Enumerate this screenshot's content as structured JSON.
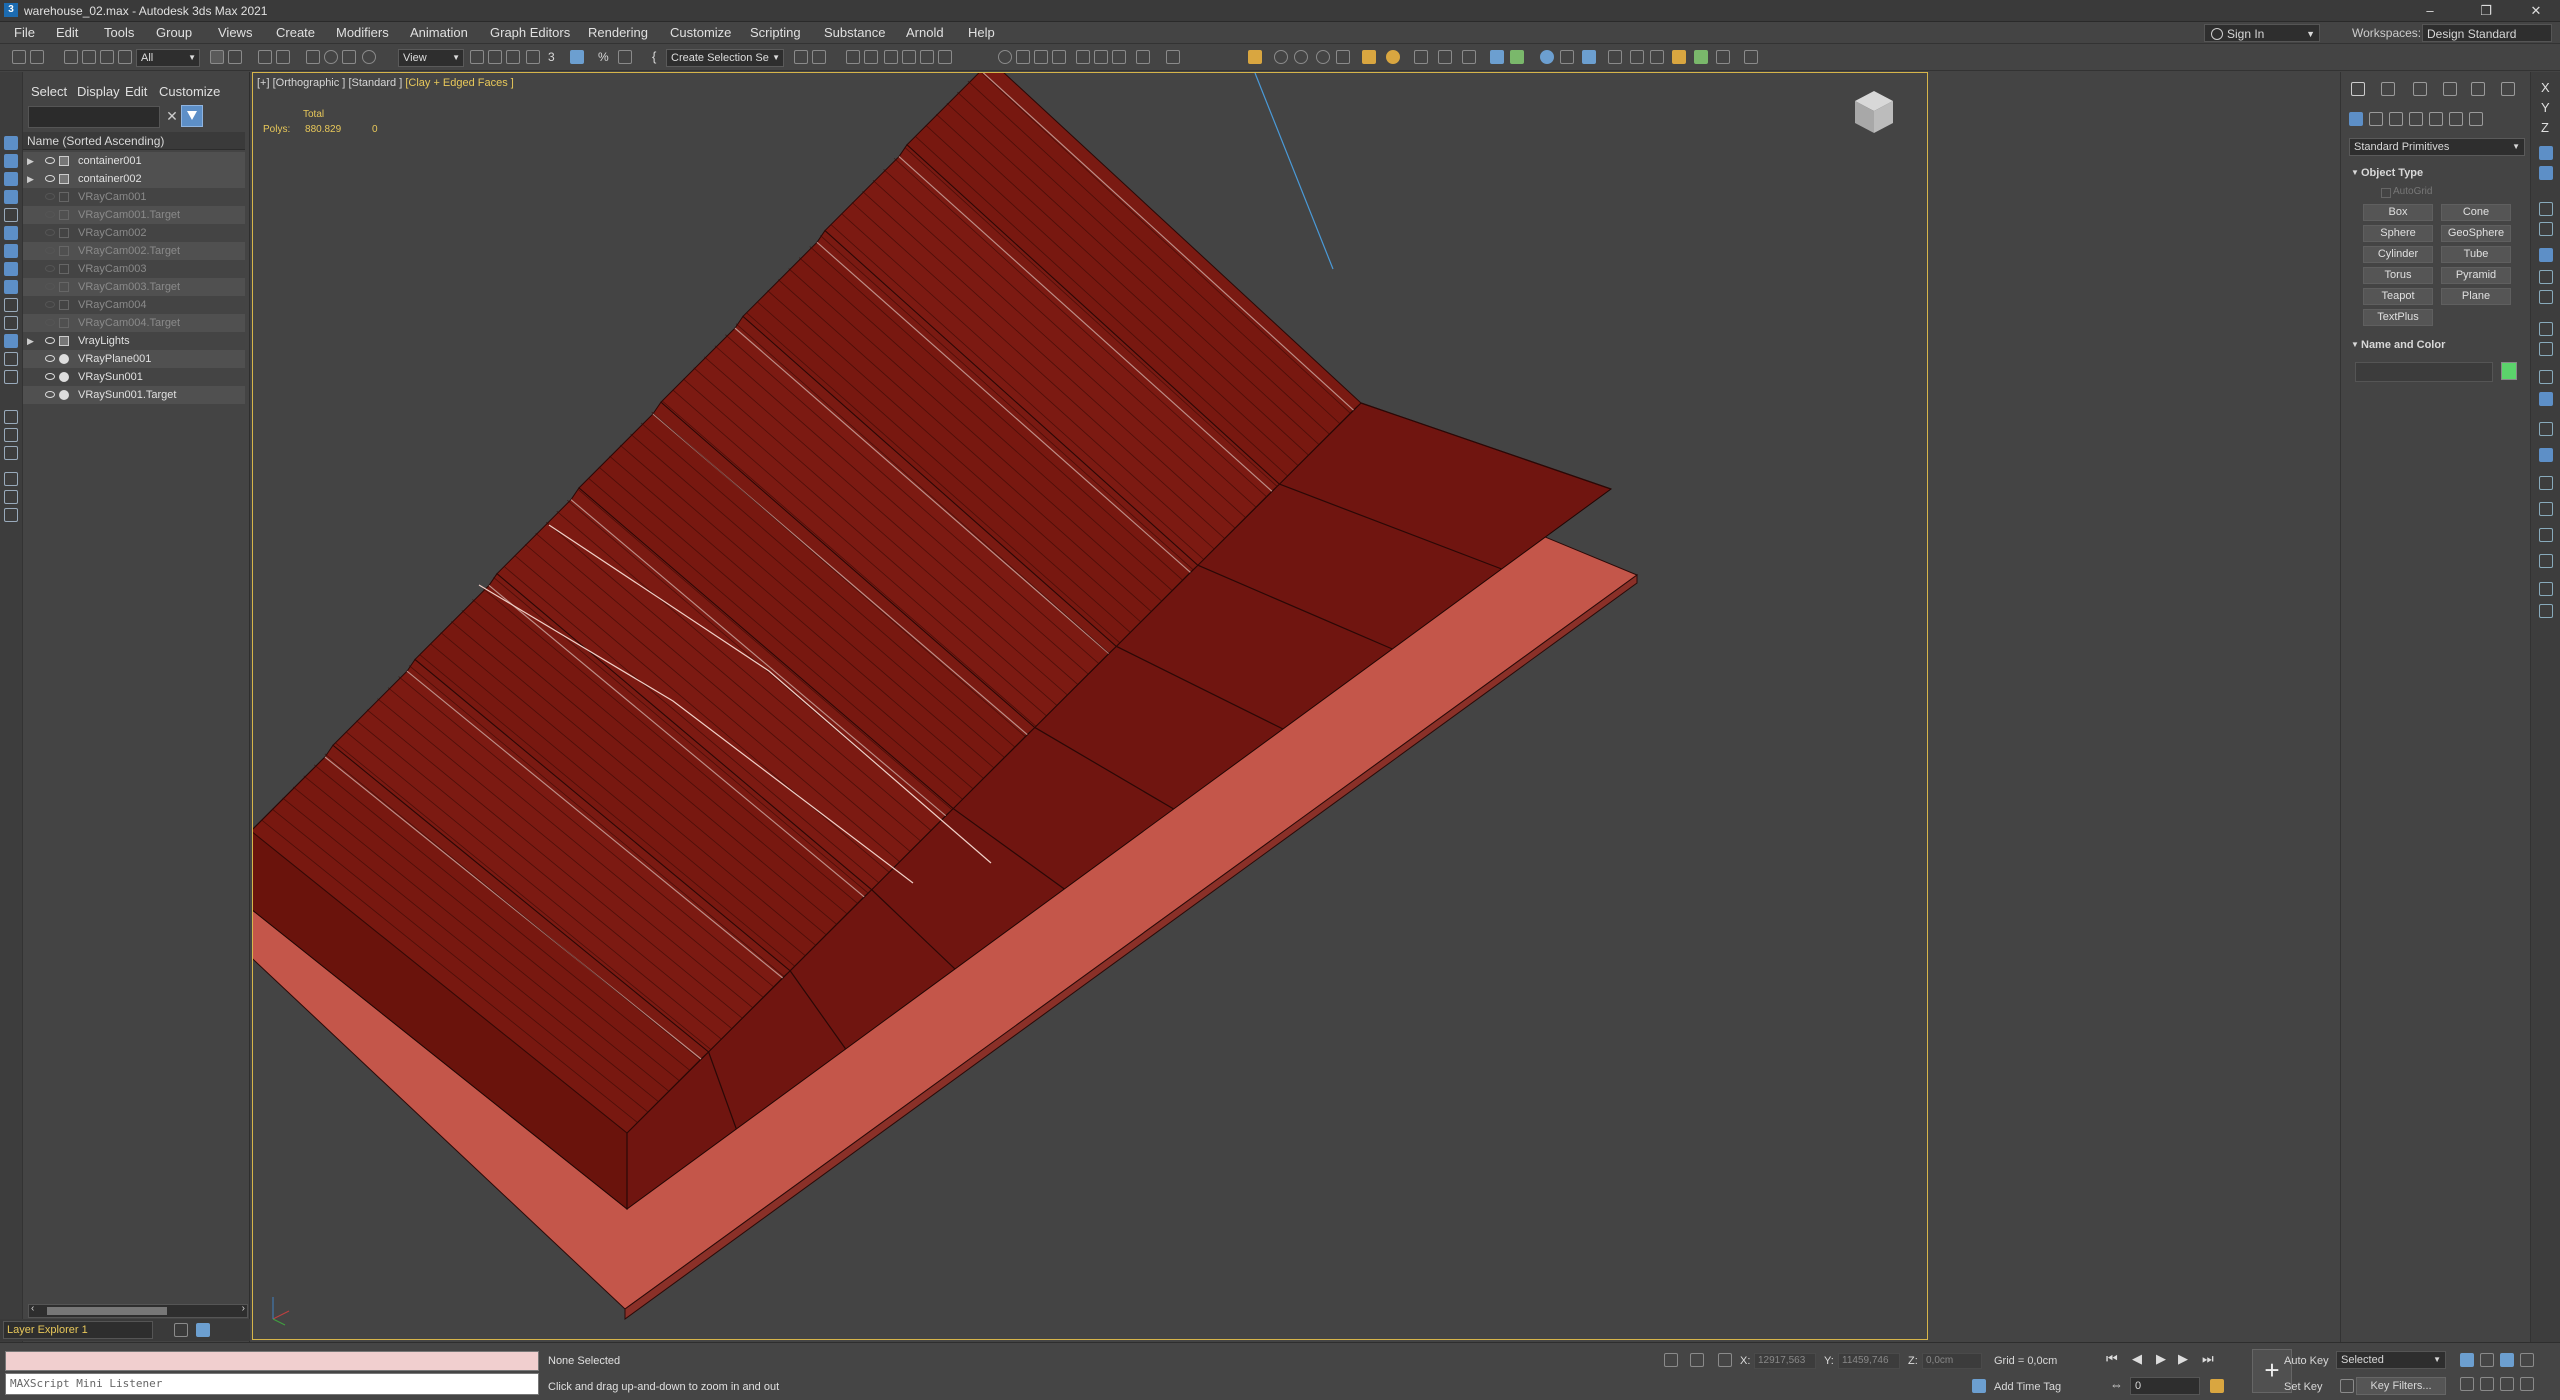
{
  "titlebar": {
    "title": "warehouse_02.max - Autodesk 3ds Max 2021",
    "app_icon": "3",
    "minimize": "–",
    "maximize": "❐",
    "close": "✕"
  },
  "menu": [
    "File",
    "Edit",
    "Tools",
    "Group",
    "Views",
    "Create",
    "Modifiers",
    "Animation",
    "Graph Editors",
    "Rendering",
    "Customize",
    "Scripting",
    "Substance",
    "Arnold",
    "Help"
  ],
  "account": {
    "sign_in": "Sign In",
    "workspaces_label": "Workspaces:",
    "workspace": "Design Standard"
  },
  "toolbar": {
    "filter": "All",
    "ref_coord": "View",
    "snap_3": "3",
    "snap_angle": "∠",
    "snap_percent": "%",
    "selection_set": "Create Selection Se",
    "brace": "{"
  },
  "explorer": {
    "tabs": [
      "Select",
      "Display",
      "Edit",
      "Customize"
    ],
    "column_header": "Name (Sorted Ascending)",
    "rows": [
      {
        "name": "container001",
        "icon": "box",
        "expander": true,
        "dim": false,
        "visible": true,
        "selected": true
      },
      {
        "name": "container002",
        "icon": "box",
        "expander": true,
        "dim": false,
        "visible": true,
        "selected": true
      },
      {
        "name": "VRayCam001",
        "icon": "cam",
        "expander": false,
        "dim": true,
        "visible": false,
        "selected": false
      },
      {
        "name": "VRayCam001.Target",
        "icon": "cam",
        "expander": false,
        "dim": true,
        "visible": false,
        "selected": true
      },
      {
        "name": "VRayCam002",
        "icon": "cam",
        "expander": false,
        "dim": true,
        "visible": false,
        "selected": false
      },
      {
        "name": "VRayCam002.Target",
        "icon": "cam",
        "expander": false,
        "dim": true,
        "visible": false,
        "selected": true
      },
      {
        "name": "VRayCam003",
        "icon": "cam",
        "expander": false,
        "dim": true,
        "visible": false,
        "selected": false
      },
      {
        "name": "VRayCam003.Target",
        "icon": "cam",
        "expander": false,
        "dim": true,
        "visible": false,
        "selected": true
      },
      {
        "name": "VRayCam004",
        "icon": "cam",
        "expander": false,
        "dim": true,
        "visible": false,
        "selected": false
      },
      {
        "name": "VRayCam004.Target",
        "icon": "cam",
        "expander": false,
        "dim": true,
        "visible": false,
        "selected": true
      },
      {
        "name": "VrayLights",
        "icon": "box",
        "expander": true,
        "dim": false,
        "visible": true,
        "selected": false
      },
      {
        "name": "VRayPlane001",
        "icon": "light",
        "expander": false,
        "dim": false,
        "visible": true,
        "selected": true
      },
      {
        "name": "VRaySun001",
        "icon": "light",
        "expander": false,
        "dim": false,
        "visible": true,
        "selected": false
      },
      {
        "name": "VRaySun001.Target",
        "icon": "light",
        "expander": false,
        "dim": false,
        "visible": true,
        "selected": true
      }
    ],
    "scroll_left": "‹",
    "scroll_right": "›"
  },
  "layer": {
    "name": "Layer Explorer 1"
  },
  "viewport": {
    "label_plus": "[+]",
    "label_view": "[Orthographic ]",
    "label_shading": "[Standard ]",
    "label_mode": "[Clay + Edged Faces ]",
    "stats_total": "Total",
    "stats_polys_label": "Polys:",
    "stats_polys_value": "880.829",
    "stats_polys_sel": "0",
    "building_color": "#7a1a12",
    "slab_color": "#c4564a"
  },
  "command_panel": {
    "category": "Standard Primitives",
    "object_type_title": "Object Type",
    "autogrid": "AutoGrid",
    "primitives": [
      "Box",
      "Cone",
      "Sphere",
      "GeoSphere",
      "Cylinder",
      "Tube",
      "Torus",
      "Pyramid",
      "Teapot",
      "Plane",
      "TextPlus"
    ],
    "name_color_title": "Name and Color",
    "object_color": "#5bd36b"
  },
  "right_strip_letters": [
    "X",
    "Y",
    "Z"
  ],
  "status": {
    "maxscript_placeholder": "MAXScript Mini Listener",
    "selection": "None Selected",
    "prompt": "Click and drag up-and-down to zoom in and out",
    "x_label": "X:",
    "x_value": "12917,563",
    "y_label": "Y:",
    "y_value": "11459,746",
    "z_label": "Z:",
    "z_value": "0,0cm",
    "grid": "Grid = 0,0cm",
    "add_time_tag": "Add Time Tag",
    "frame": "0",
    "auto_key": "Auto Key",
    "set_key": "Set Key",
    "selected_mode": "Selected",
    "key_filters": "Key Filters..."
  }
}
